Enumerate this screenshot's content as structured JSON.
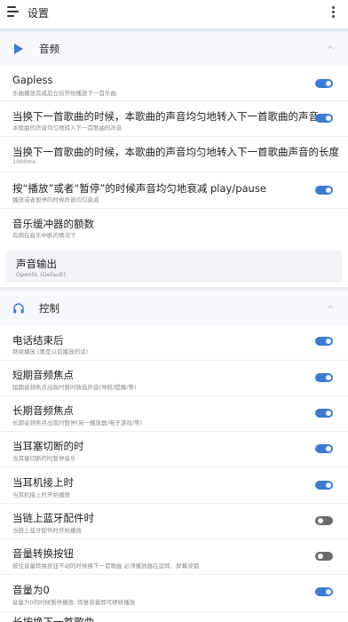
{
  "appbar": {
    "title": "设置"
  },
  "audio_section": {
    "title": "音频",
    "items": [
      {
        "title": "Gapless",
        "subtitle": "乐曲播放完成后立刻开始播放下一首乐曲.",
        "toggle": "on"
      },
      {
        "title": "当换下一首歌曲的时候，本歌曲的声音均匀地转入下一首歌曲的声音",
        "subtitle": "本歌曲的声音均匀地转入下一首歌曲的声音",
        "toggle": "on"
      },
      {
        "title": "当换下一首歌曲的时候，本歌曲的声音均匀地转入下一首歌曲声音的长度",
        "subtitle": "1000ms"
      },
      {
        "title": "按“播放”或者“暂停”的时候声音均匀地衰减 play/pause",
        "subtitle": "播放或者暂停的时候声音均匀衰减",
        "toggle": "on"
      },
      {
        "title": "音乐缓冲器的额数",
        "subtitle": "有用在音乐中断的情况下"
      }
    ],
    "output": {
      "title": "声音输出",
      "subtitle": "OpenSL (Default)"
    }
  },
  "control_section": {
    "title": "控制",
    "items": [
      {
        "title": "电话结束后",
        "subtitle": "继续播放 (要是以前播放的话)",
        "toggle": "on"
      },
      {
        "title": "短期音频焦点",
        "subtitle": "短期音频焦点出现时暂时放低声音(导航/提醒/等)",
        "toggle": "on"
      },
      {
        "title": "长期音频焦点",
        "subtitle": "长期音频焦点出现时暂停(另一播放器/电子游戏/等)",
        "toggle": "on"
      },
      {
        "title": "当耳塞切断的时",
        "subtitle": "当耳塞切断的时暂停音乐",
        "toggle": "on"
      },
      {
        "title": "当耳机接上时",
        "subtitle": "当耳机接上时开始播放",
        "toggle": "on"
      },
      {
        "title": "当链上蓝牙配件时",
        "subtitle": "当链上蓝牙配件时开始播放",
        "toggle": "off"
      },
      {
        "title": "音量转换按钮",
        "subtitle": "按住音量转换按钮不动的时候换下一首歌曲 必须播放器在运转、屏幕没锁",
        "toggle": "off"
      },
      {
        "title": "音量为0",
        "subtitle": "音量为0的时候暂停播放, 恢复音量即可继续播放",
        "toggle": "on"
      },
      {
        "title": "长按换下一首歌曲"
      }
    ]
  },
  "colors": {
    "accent": "#3a7bd5",
    "toggle_off": "#6a6a6a"
  },
  "icons": {
    "menu": "hamburger-icon",
    "more": "more-vert-icon",
    "audio": "play-triangle-icon",
    "control": "headphones-icon",
    "collapse": "chevron-up-icon"
  }
}
